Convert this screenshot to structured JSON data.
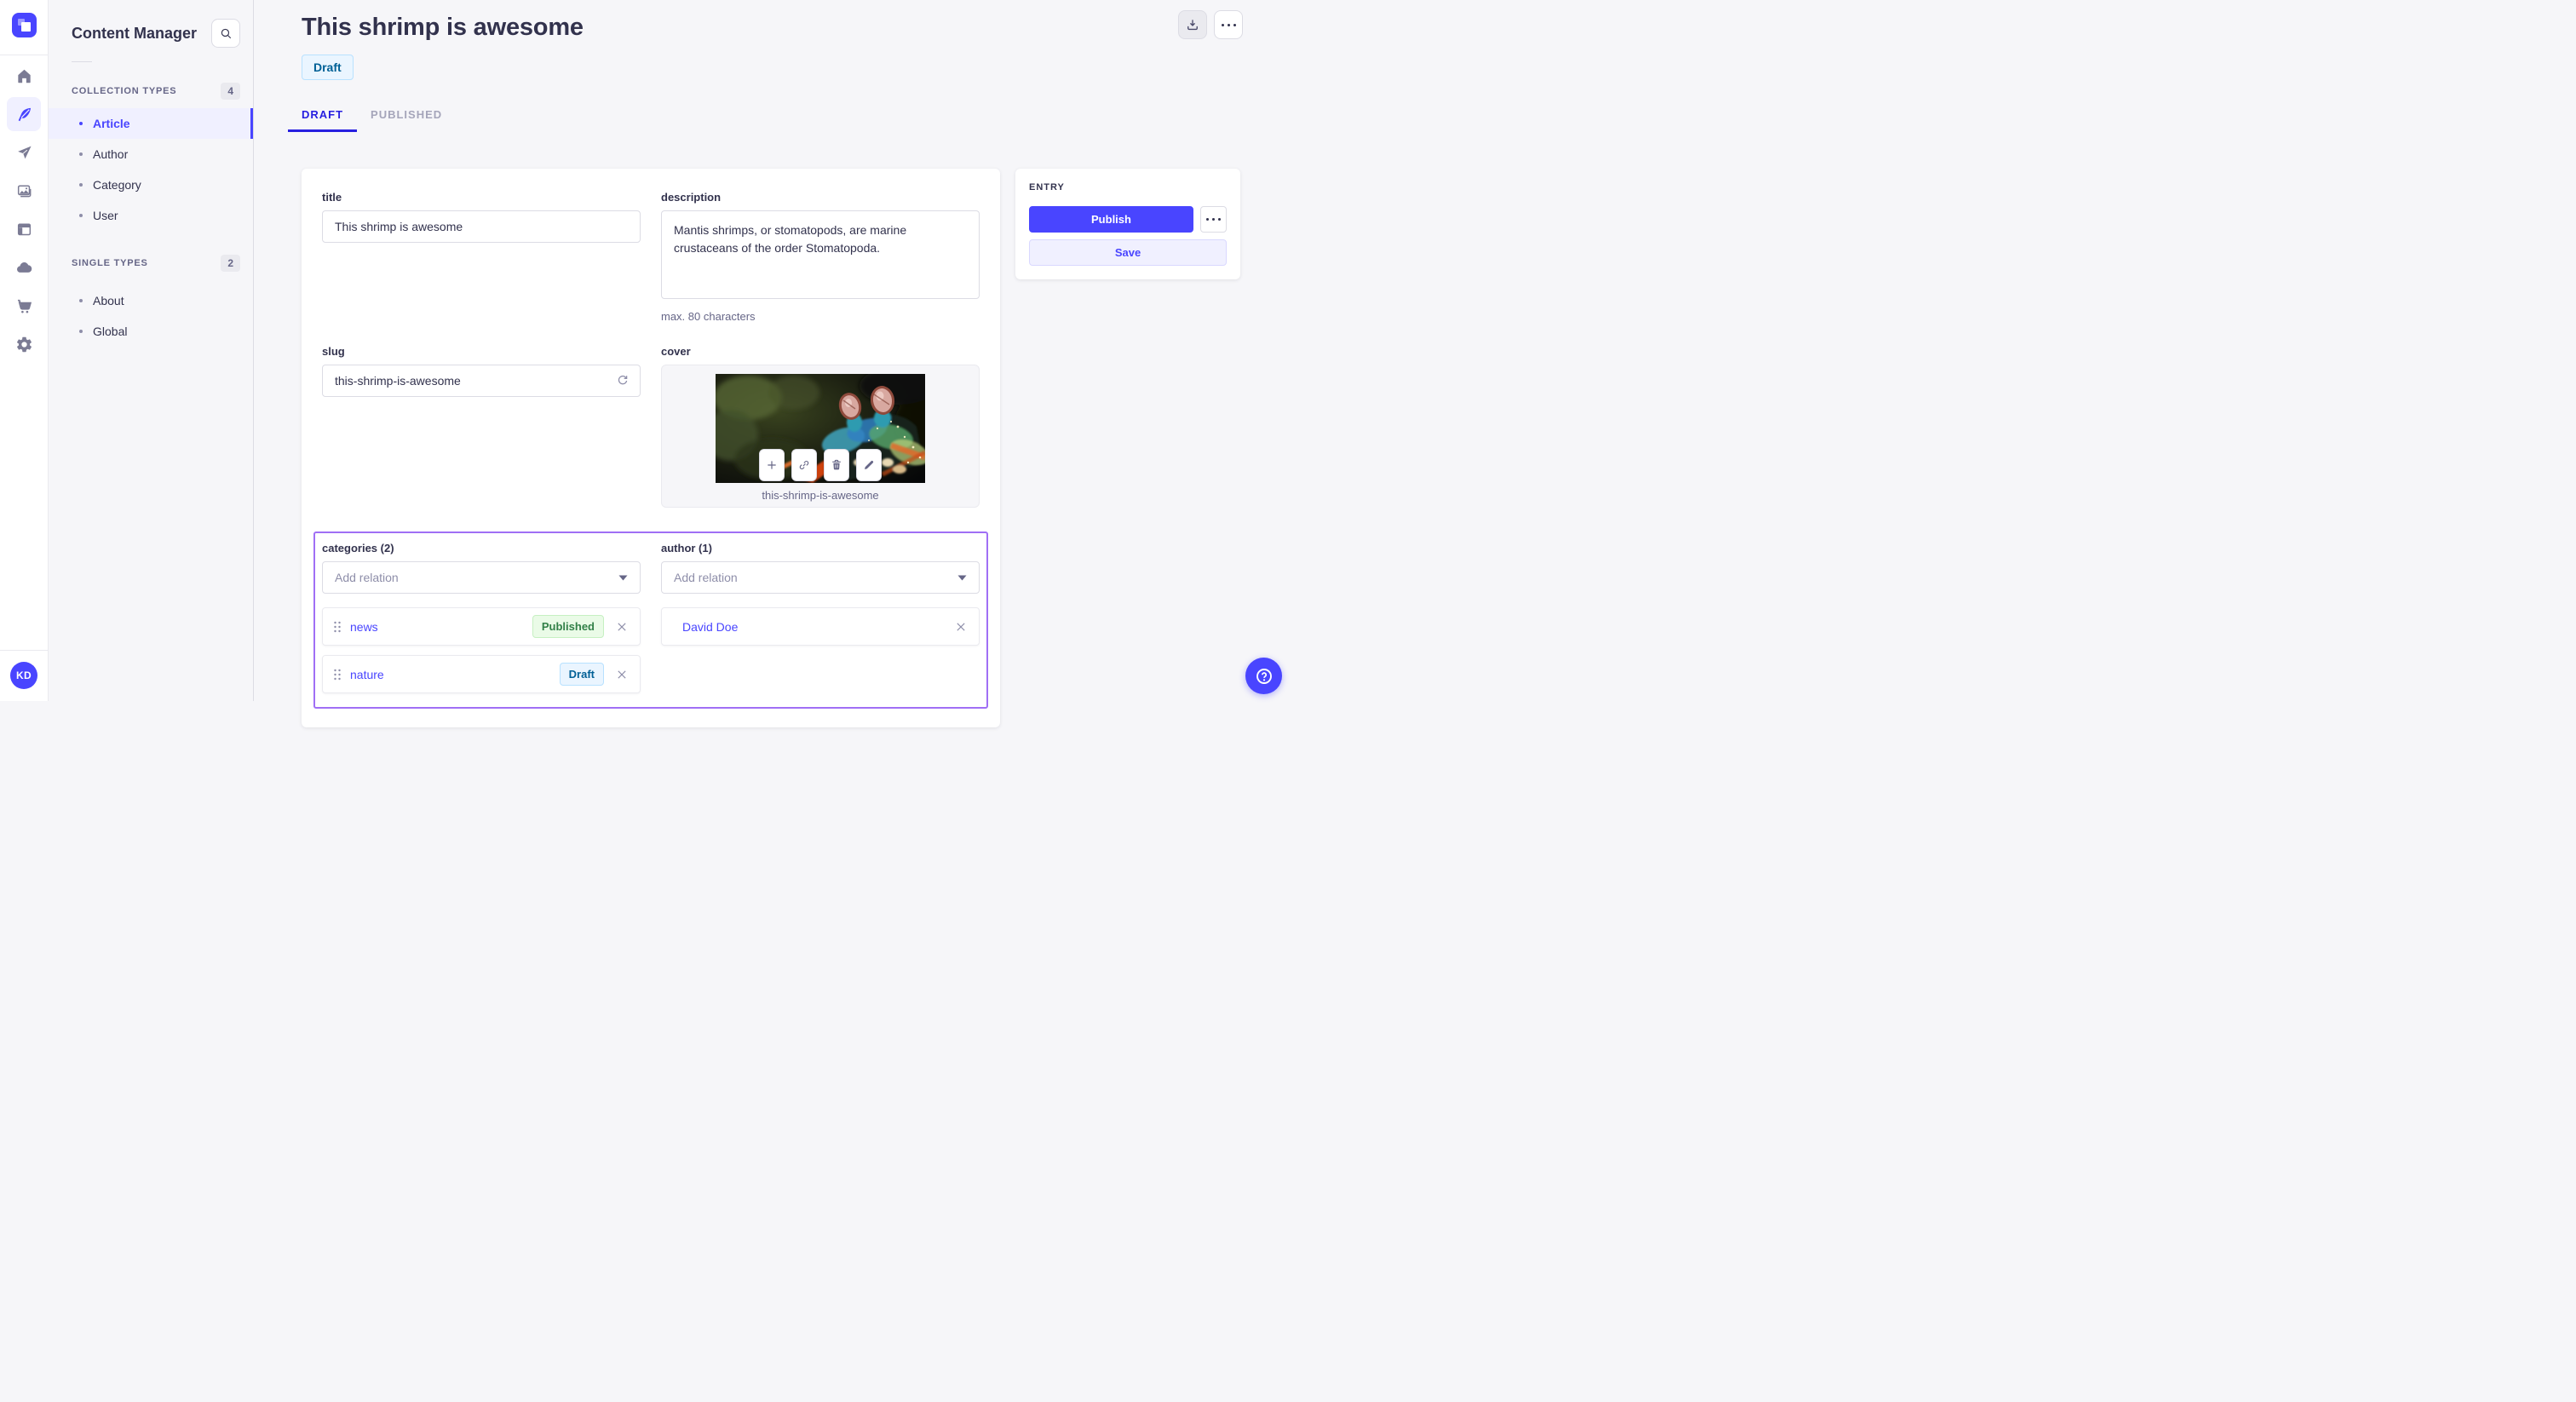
{
  "colors": {
    "accent": "#4945FF",
    "accent_dark": "#271FE0",
    "accent_light_bg": "#F0F0FF",
    "highlight_outline": "#A06FF5",
    "draft_text": "#006096",
    "draft_bg": "#EAF5FF",
    "success_text": "#328048",
    "success_bg": "#EAFBE7",
    "page_bg": "#F6F6F9",
    "border": "#DCDCE4"
  },
  "iconbar": {
    "icons": [
      "strapi-logo",
      "home",
      "content-manager-feather",
      "release-send",
      "media-library-images",
      "content-type-builder-layout",
      "deploy-cloud",
      "marketplace-cart",
      "settings-gear"
    ],
    "active_icon": "content-manager-feather",
    "avatar_initials": "KD"
  },
  "subnav": {
    "title": "Content Manager",
    "sections": [
      {
        "label": "COLLECTION TYPES",
        "count": "4",
        "items": [
          {
            "label": "Article",
            "active": true
          },
          {
            "label": "Author"
          },
          {
            "label": "Category"
          },
          {
            "label": "User"
          }
        ]
      },
      {
        "label": "SINGLE TYPES",
        "count": "2",
        "items": [
          {
            "label": "About"
          },
          {
            "label": "Global"
          }
        ]
      }
    ]
  },
  "header": {
    "title": "This shrimp is awesome",
    "status": "Draft",
    "tabs": [
      {
        "label": "DRAFT",
        "active": true
      },
      {
        "label": "PUBLISHED"
      }
    ]
  },
  "form": {
    "title": {
      "label": "title",
      "value": "This shrimp is awesome"
    },
    "description": {
      "label": "description",
      "value": "Mantis shrimps, or stomatopods, are marine crustaceans of the order Stomatopoda.",
      "hint": "max. 80 characters"
    },
    "slug": {
      "label": "slug",
      "value": "this-shrimp-is-awesome"
    },
    "cover": {
      "label": "cover",
      "caption": "this-shrimp-is-awesome"
    },
    "categories": {
      "label": "categories (2)",
      "placeholder": "Add relation",
      "items": [
        {
          "name": "news",
          "status": "Published"
        },
        {
          "name": "nature",
          "status": "Draft"
        }
      ]
    },
    "author": {
      "label": "author (1)",
      "placeholder": "Add relation",
      "items": [
        {
          "name": "David Doe"
        }
      ]
    }
  },
  "entry": {
    "label": "ENTRY",
    "publish": "Publish",
    "save": "Save"
  }
}
